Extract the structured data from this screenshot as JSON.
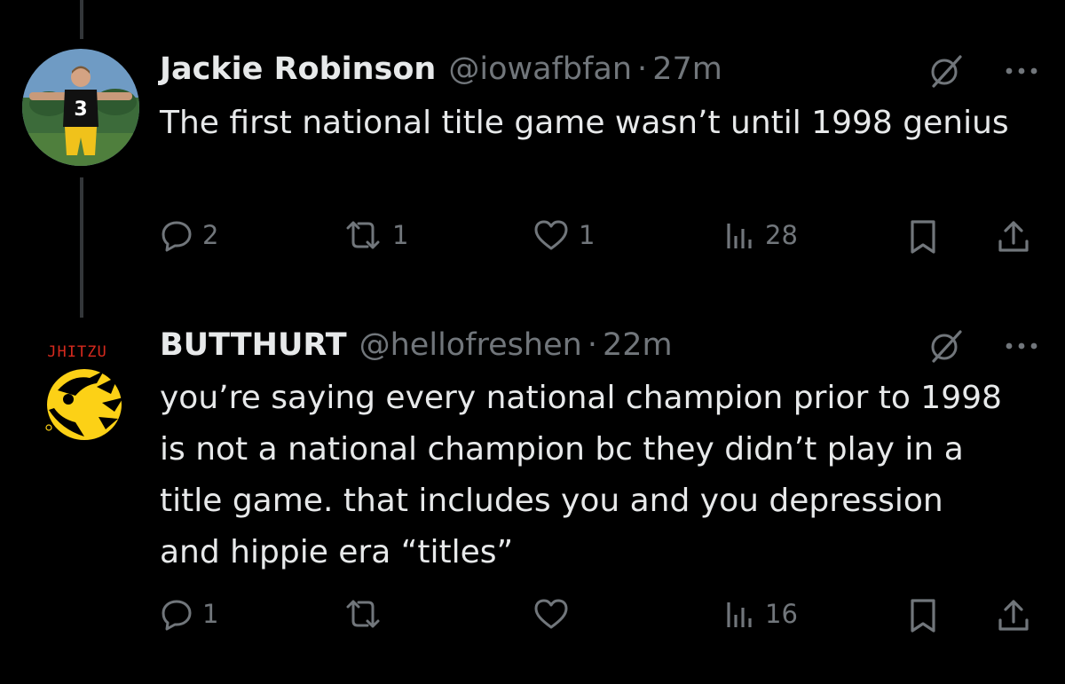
{
  "tweets": [
    {
      "name": "Jackie Robinson",
      "handle": "@iowafbfan",
      "separator": "·",
      "time": "27m",
      "text": "The first national title game wasn’t until 1998 genius",
      "replies": "2",
      "reposts": "1",
      "likes": "1",
      "views": "28",
      "avatar_jersey_number": "3"
    },
    {
      "name": "BUTTHURT",
      "handle": "@hellofreshen",
      "separator": "·",
      "time": "22m",
      "text": "you’re saying every national champion prior to 1998 is not a national champion bc they didn’t play in a title game. that includes you and you depression and hippie era “titles”",
      "replies": "1",
      "reposts": "",
      "likes": "",
      "views": "16",
      "avatar_logo_text": "JHITZU"
    }
  ],
  "colors": {
    "background": "#000000",
    "text_primary": "#e7e9ea",
    "text_secondary": "#71767b",
    "thread_line": "#333639",
    "hawkeye_yellow": "#fcd116"
  },
  "icons": [
    "grok-slash-icon",
    "more-icon",
    "reply-icon",
    "repost-icon",
    "like-icon",
    "views-icon",
    "bookmark-icon",
    "share-icon"
  ]
}
